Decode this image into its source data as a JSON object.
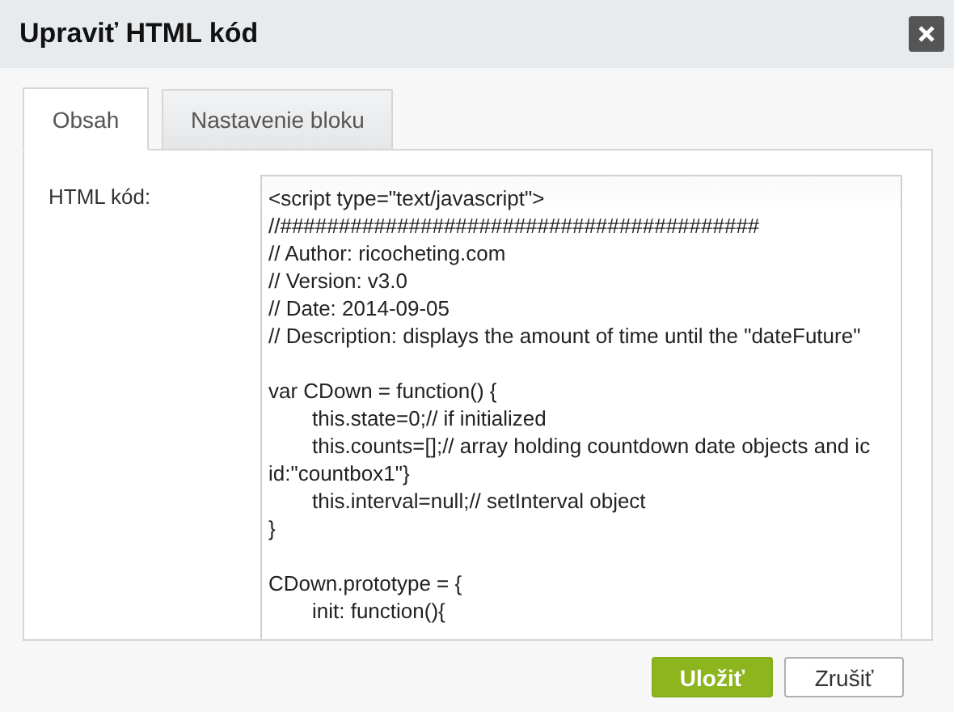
{
  "dialog": {
    "title": "Upraviť HTML kód"
  },
  "tabs": [
    {
      "label": "Obsah",
      "selected": true
    },
    {
      "label": "Nastavenie bloku",
      "selected": false
    }
  ],
  "form": {
    "label": "HTML kód:",
    "code_blocks": [
      {
        "lines": [
          {
            "text": "<script type=\"text/javascript\">",
            "indented": false
          },
          {
            "text": "//#########################################",
            "indented": false
          },
          {
            "text": "// Author: ricocheting.com",
            "indented": false
          },
          {
            "text": "// Version: v3.0",
            "indented": false
          },
          {
            "text": "// Date: 2014-09-05",
            "indented": false
          },
          {
            "text": "// Description: displays the amount of time until the \"dateFuture\"",
            "indented": false
          }
        ]
      },
      {
        "lines": [
          {
            "text": "var CDown = function() {",
            "indented": false
          },
          {
            "text": "this.state=0;// if initialized",
            "indented": true
          },
          {
            "text": "this.counts=[];// array holding countdown date objects and ic",
            "indented": true
          },
          {
            "text": "id:\"countbox1\"}",
            "indented": false
          },
          {
            "text": "this.interval=null;// setInterval object",
            "indented": true
          },
          {
            "text": "}",
            "indented": false
          }
        ]
      },
      {
        "lines": [
          {
            "text": "CDown.prototype = {",
            "indented": false
          },
          {
            "text": "init: function(){",
            "indented": true
          }
        ]
      }
    ]
  },
  "buttons": [
    {
      "label": "Uložiť",
      "kind": "primary"
    },
    {
      "label": "Zrušiť",
      "kind": "secondary"
    }
  ]
}
